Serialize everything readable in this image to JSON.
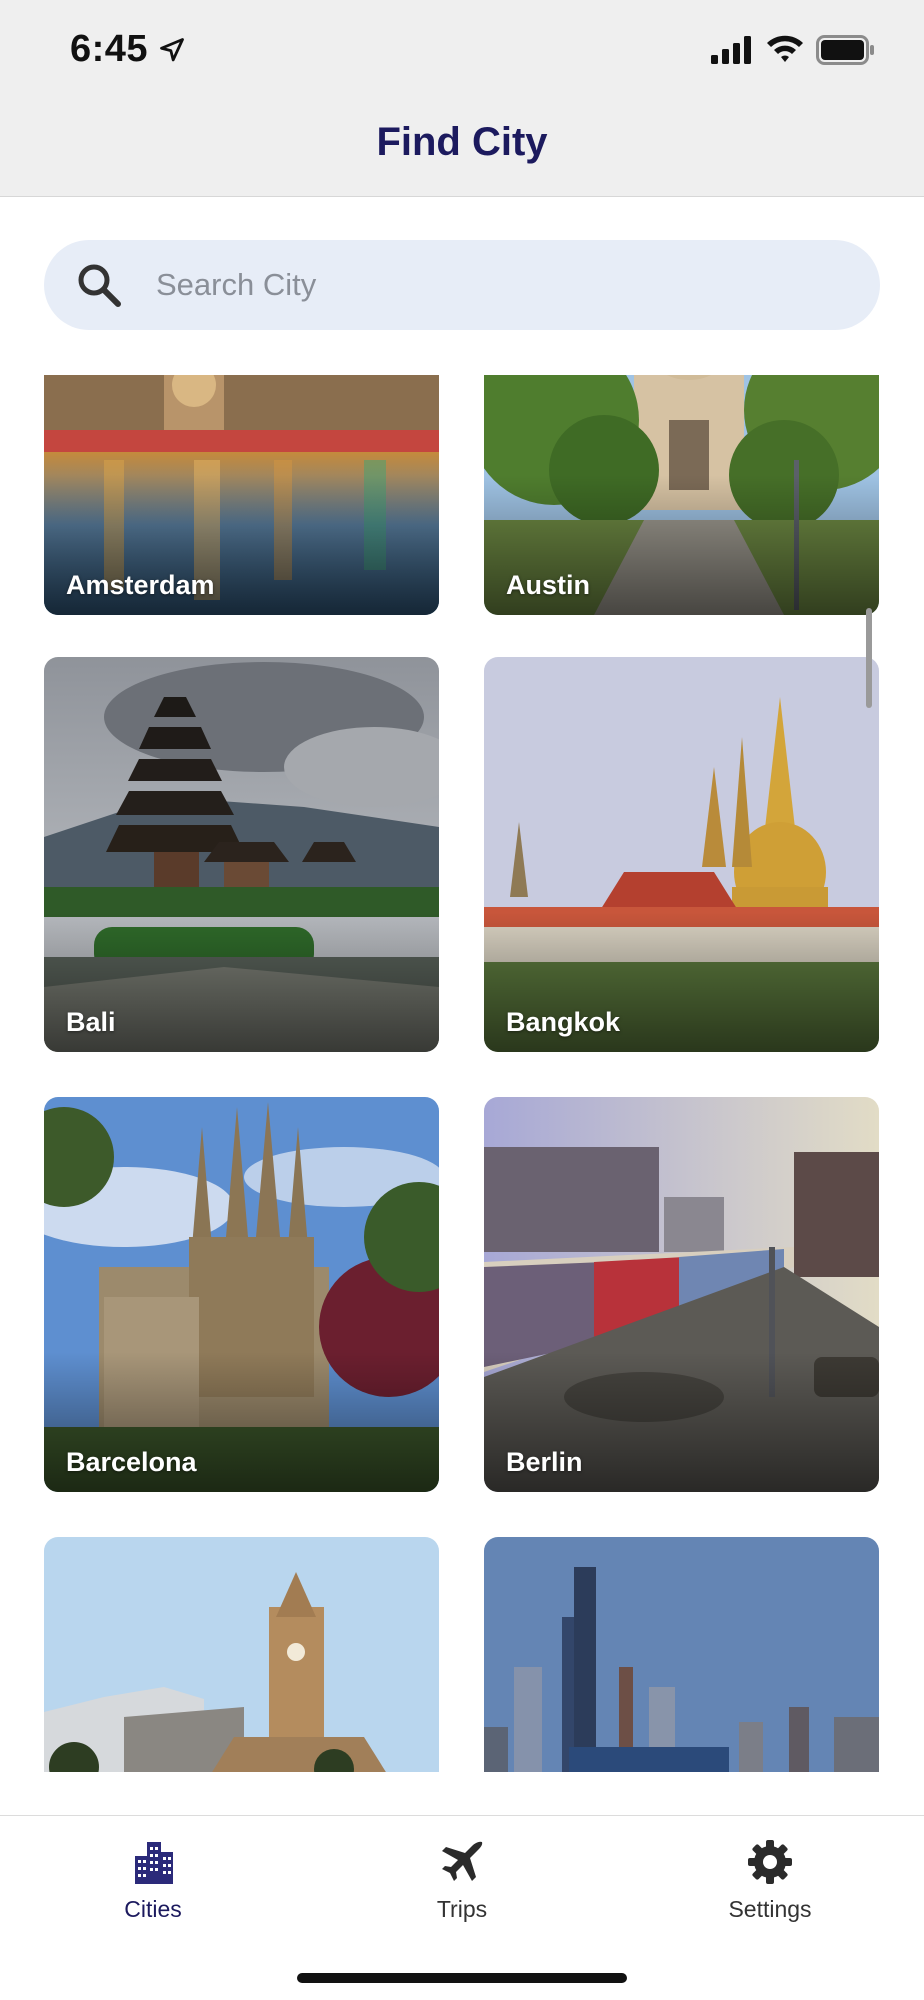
{
  "status_bar": {
    "time": "6:45"
  },
  "header": {
    "title": "Find City"
  },
  "search": {
    "placeholder": "Search City"
  },
  "cities": [
    {
      "name": "Amsterdam"
    },
    {
      "name": "Austin"
    },
    {
      "name": "Bali"
    },
    {
      "name": "Bangkok"
    },
    {
      "name": "Barcelona"
    },
    {
      "name": "Berlin"
    },
    {
      "name": ""
    },
    {
      "name": ""
    }
  ],
  "tabs": [
    {
      "label": "Cities",
      "icon": "buildings-icon",
      "active": true
    },
    {
      "label": "Trips",
      "icon": "airplane-icon",
      "active": false
    },
    {
      "label": "Settings",
      "icon": "gear-icon",
      "active": false
    }
  ],
  "colors": {
    "accent": "#1c1a5e",
    "search_bg": "#e7edf7",
    "inactive": "#333333"
  }
}
